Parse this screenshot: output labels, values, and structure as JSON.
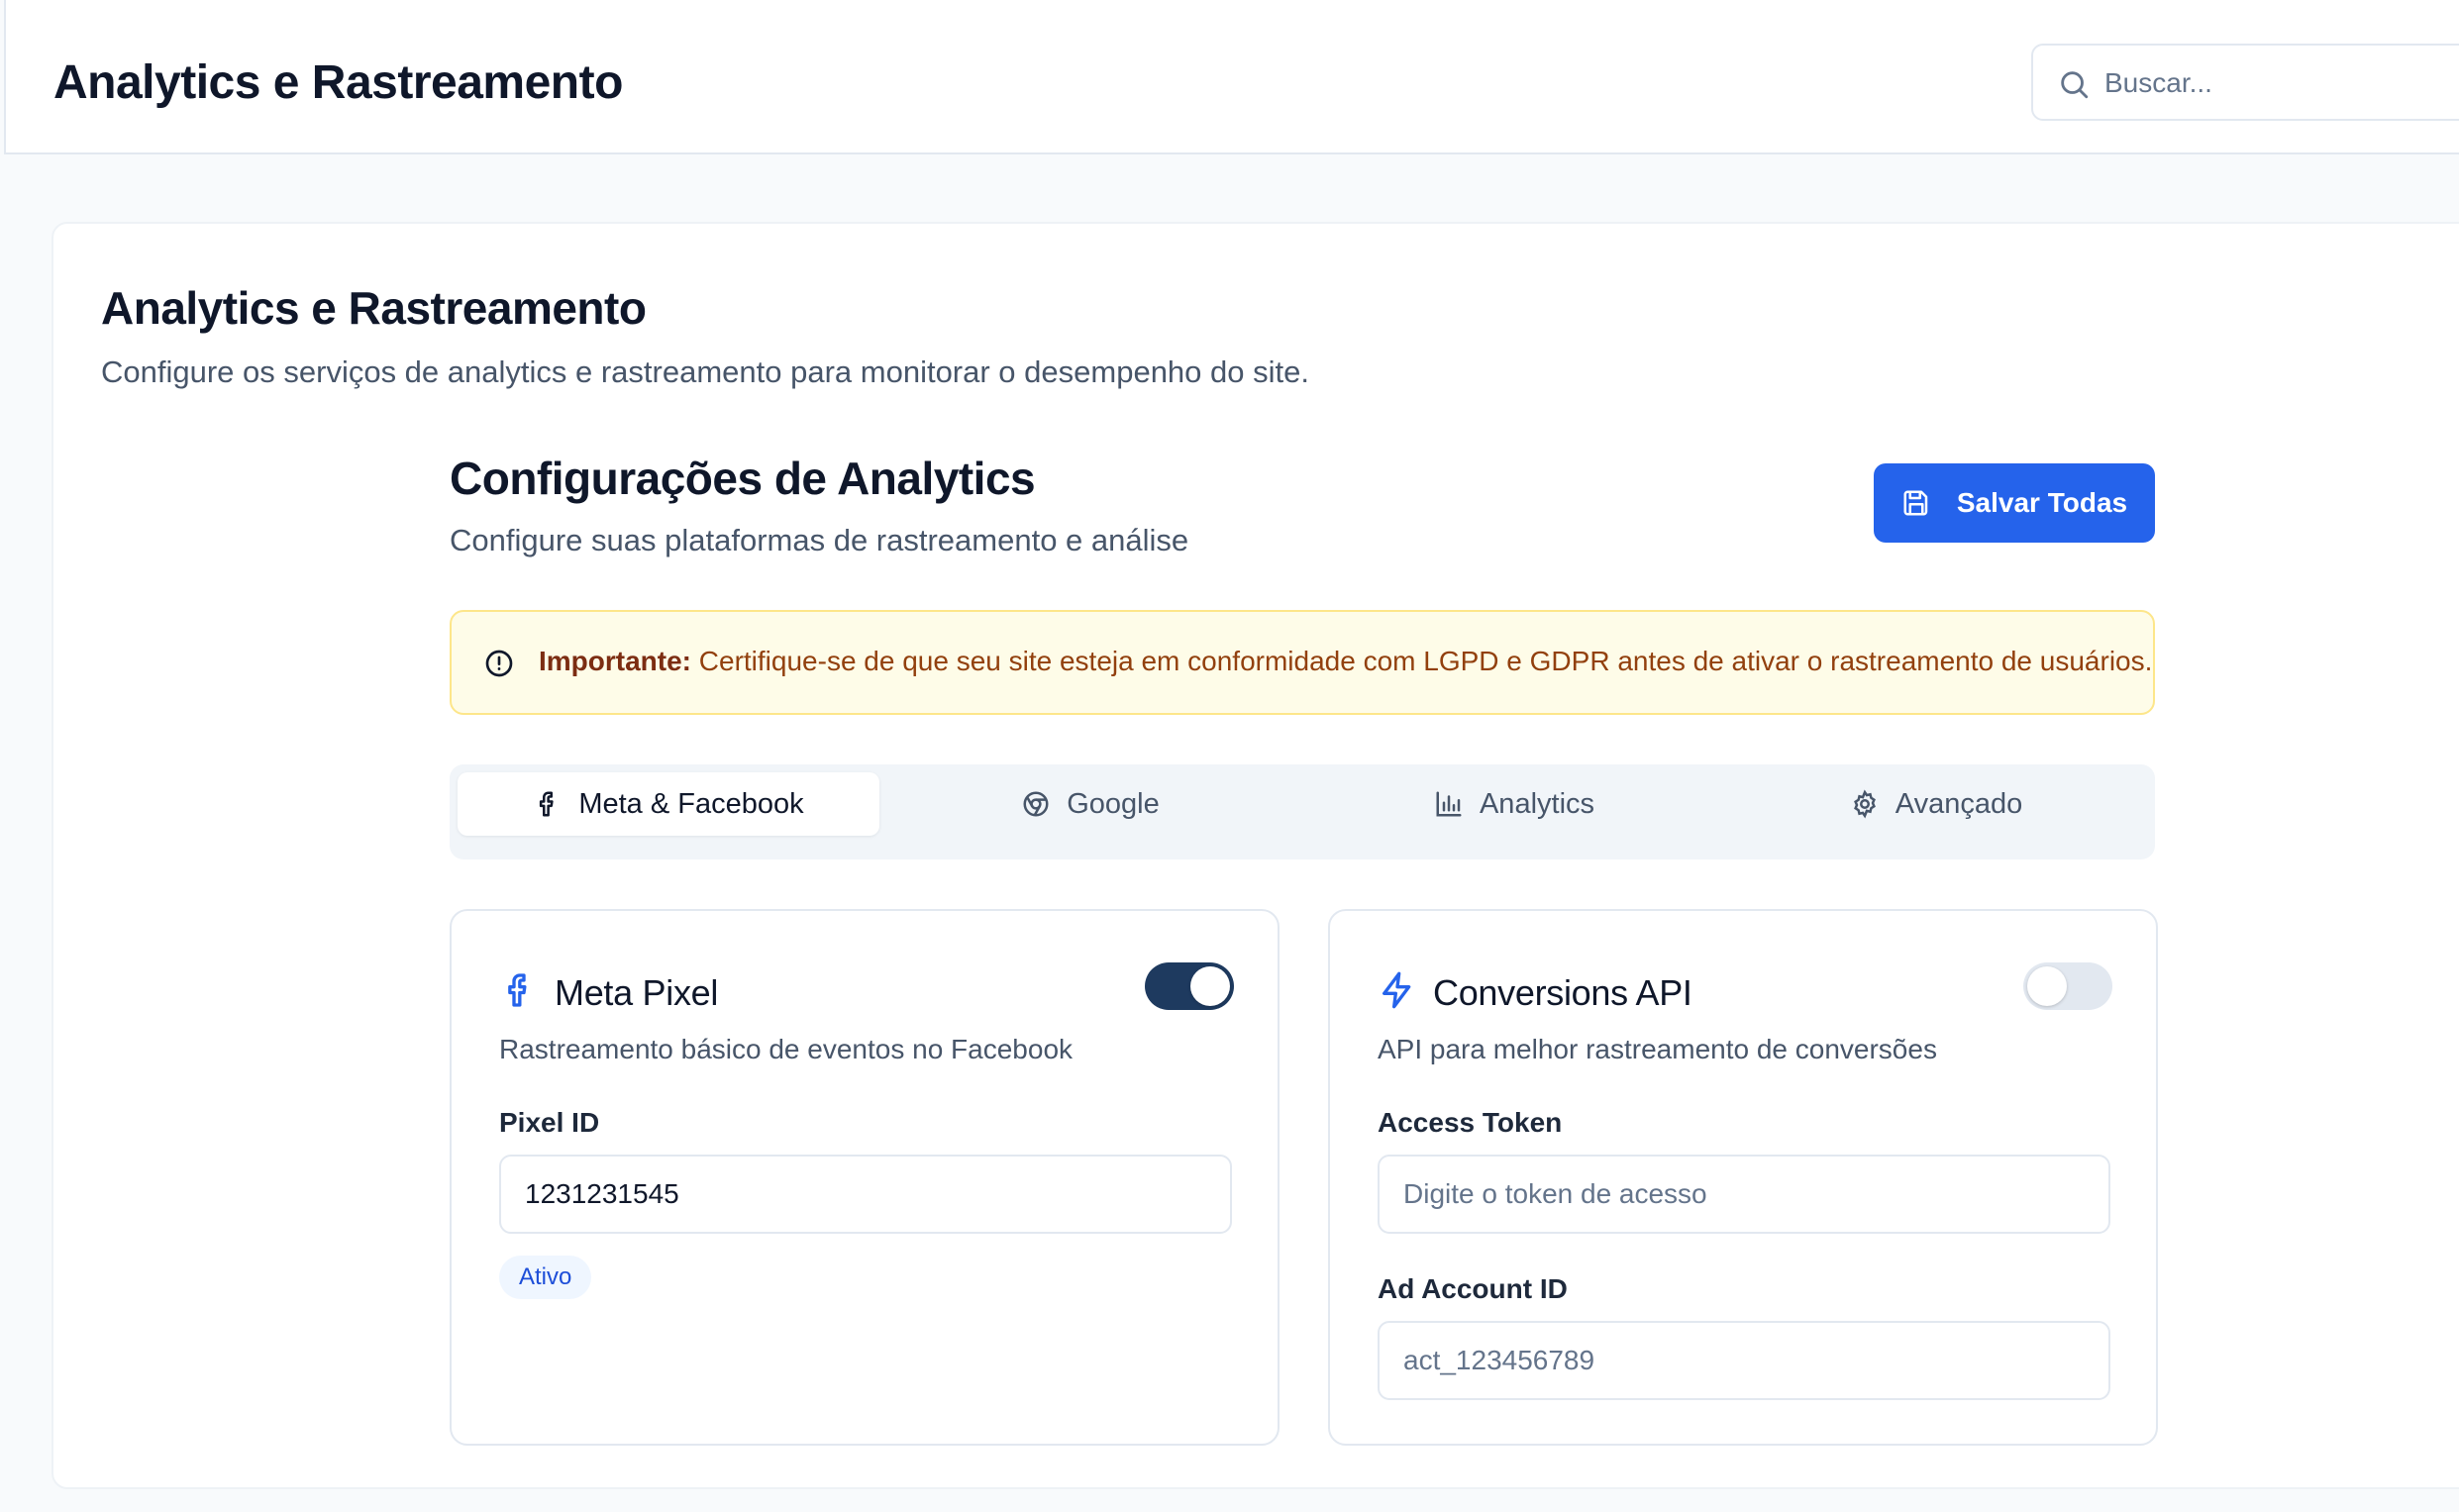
{
  "header": {
    "title": "Analytics e Rastreamento",
    "search_placeholder": "Buscar..."
  },
  "page": {
    "title": "Analytics e Rastreamento",
    "subtitle": "Configure os serviços de analytics e rastreamento para monitorar o desempenho do site."
  },
  "section": {
    "title": "Configurações de Analytics",
    "subtitle": "Configure suas plataformas de rastreamento e análise",
    "save_label": "Salvar Todas"
  },
  "alert": {
    "strong": "Importante:",
    "text": " Certifique-se de que seu site esteja em conformidade com LGPD e GDPR antes de ativar o rastreamento de usuários."
  },
  "tabs": [
    {
      "label": "Meta & Facebook",
      "icon": "facebook-icon",
      "active": true
    },
    {
      "label": "Google",
      "icon": "chrome-icon",
      "active": false
    },
    {
      "label": "Analytics",
      "icon": "bar-chart-icon",
      "active": false
    },
    {
      "label": "Avançado",
      "icon": "gear-icon",
      "active": false
    }
  ],
  "meta_pixel": {
    "title": "Meta Pixel",
    "description": "Rastreamento básico de eventos no Facebook",
    "enabled": true,
    "field_label": "Pixel ID",
    "field_value": "1231231545",
    "status_badge": "Ativo"
  },
  "conversions_api": {
    "title": "Conversions API",
    "description": "API para melhor rastreamento de conversões",
    "enabled": false,
    "token_label": "Access Token",
    "token_placeholder": "Digite o token de acesso",
    "account_label": "Ad Account ID",
    "account_placeholder": "act_123456789"
  },
  "colors": {
    "primary": "#2563eb",
    "toggle_on": "#1e3a5f",
    "alert_bg": "#fefce8",
    "alert_border": "#fde68a",
    "alert_text": "#92400e"
  }
}
